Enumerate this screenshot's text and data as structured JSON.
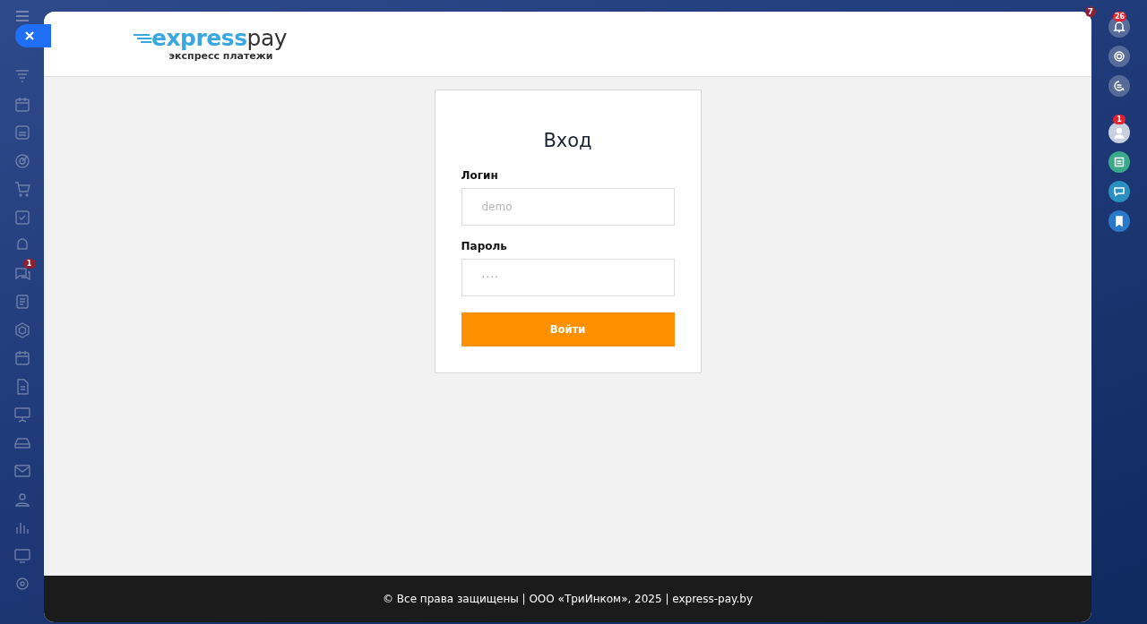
{
  "left_rail": {
    "chat_badge": "1"
  },
  "right_rail": {
    "corner_badge": "7",
    "notifications_badge": "26",
    "avatar_badge": "1"
  },
  "header": {
    "logo": {
      "brand_a": "express",
      "brand_b": "pay",
      "tagline": "экспресс платежи"
    }
  },
  "login": {
    "title": "Вход",
    "fields": [
      {
        "label": "Логин",
        "placeholder": "demo",
        "kind": "text"
      },
      {
        "label": "Пароль",
        "placeholder": "····",
        "kind": "password"
      }
    ],
    "submit": "Войти"
  },
  "footer": {
    "text": "© Все права защищены | ООО «ТриИнком», 2025 | express-pay.by"
  }
}
